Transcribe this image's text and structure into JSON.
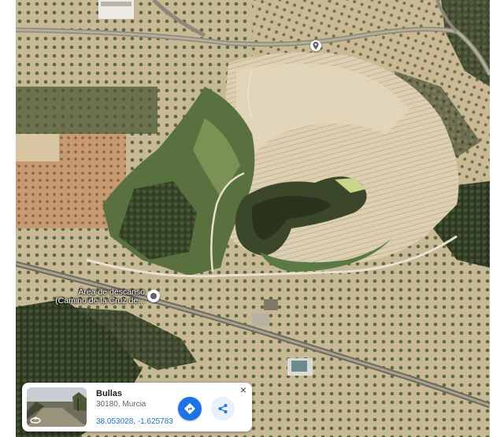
{
  "map": {
    "poi": {
      "label_line1": "Área de descanso",
      "label_line2": "(Camino de la Cruz de..."
    }
  },
  "place_card": {
    "title": "Bullas",
    "address": "30180, Murcia",
    "coordinates": "38.053028, -1.625783",
    "close_symbol": "×",
    "actions": [
      "directions-icon",
      "share-icon"
    ]
  },
  "colors": {
    "accent": "#1a73e8",
    "water": "#3d4a2c",
    "quarry": "#d9cdb0"
  }
}
